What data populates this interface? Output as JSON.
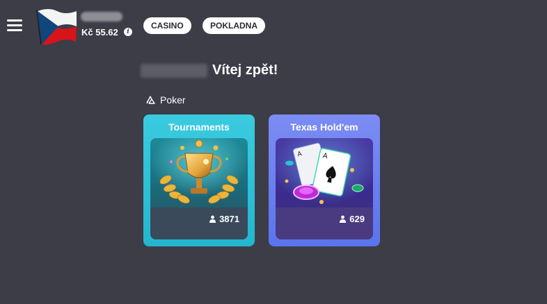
{
  "header": {
    "balance": "Kč 55.62",
    "nav": [
      {
        "label": "CASINO"
      },
      {
        "label": "POKLADNA"
      }
    ],
    "icons": {
      "menu": "hamburger-icon",
      "flag": "czech-flag",
      "info": "info-icon"
    }
  },
  "welcome": {
    "text": "Vítej zpět!"
  },
  "section": {
    "label": "Poker",
    "icon": "poker-cards-icon"
  },
  "tiles": [
    {
      "title": "Tournaments",
      "players": "3871",
      "player_icon": "user-icon",
      "accent": "#2bbfd6"
    },
    {
      "title": "Texas Hold'em",
      "players": "629",
      "player_icon": "user-icon",
      "accent": "#6a80f0"
    }
  ],
  "colors": {
    "background": "#3c3d47",
    "pill_bg": "#ffffff",
    "pill_text": "#2b2c33"
  }
}
